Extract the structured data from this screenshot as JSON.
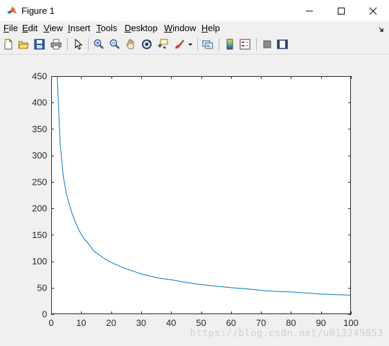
{
  "window": {
    "title": "Figure 1"
  },
  "menu": [
    "File",
    "Edit",
    "View",
    "Insert",
    "Tools",
    "Desktop",
    "Window",
    "Help"
  ],
  "toolbar": {
    "tools": [
      "new-figure-icon",
      "open-file-icon",
      "save-icon",
      "print-icon",
      "pointer-icon",
      "zoom-in-icon",
      "zoom-out-icon",
      "pan-hand-icon",
      "rotate-3d-icon",
      "data-cursor-icon",
      "brush-icon",
      "link-plot-icon",
      "colorbar-icon",
      "legend-icon",
      "hide-plot-tools-icon",
      "show-plot-tools-icon"
    ]
  },
  "colors": {
    "line": "#0072bd",
    "axis": "#262626",
    "plot_bg": "#ffffff",
    "figure_bg": "#f0f0f0"
  },
  "chart_data": {
    "type": "line",
    "title": "",
    "xlabel": "",
    "ylabel": "",
    "xlim": [
      0,
      100
    ],
    "ylim": [
      0,
      450
    ],
    "xticks": [
      0,
      10,
      20,
      30,
      40,
      50,
      60,
      70,
      80,
      90,
      100
    ],
    "yticks": [
      0,
      50,
      100,
      150,
      200,
      250,
      300,
      350,
      400,
      450
    ],
    "grid": false,
    "series": [
      {
        "color": "#0072bd",
        "x": [
          2,
          3,
          4,
          5,
          6,
          7,
          8,
          9,
          10,
          11,
          12,
          13,
          14,
          15,
          16,
          17,
          18,
          19,
          20,
          22,
          24,
          26,
          28,
          30,
          33,
          36,
          40,
          45,
          50,
          55,
          60,
          65,
          70,
          75,
          80,
          85,
          90,
          95,
          100
        ],
        "y": [
          450,
          320,
          262,
          228,
          208,
          190,
          175,
          162,
          151,
          142,
          136,
          129,
          121,
          116,
          112,
          108,
          104,
          101,
          98,
          93,
          88,
          84,
          80,
          76,
          72,
          68,
          65,
          60,
          56,
          53,
          50,
          48,
          45,
          43,
          42,
          40,
          38,
          37,
          36
        ]
      }
    ]
  },
  "watermark": "https://blog.csdn.net/u013249853"
}
